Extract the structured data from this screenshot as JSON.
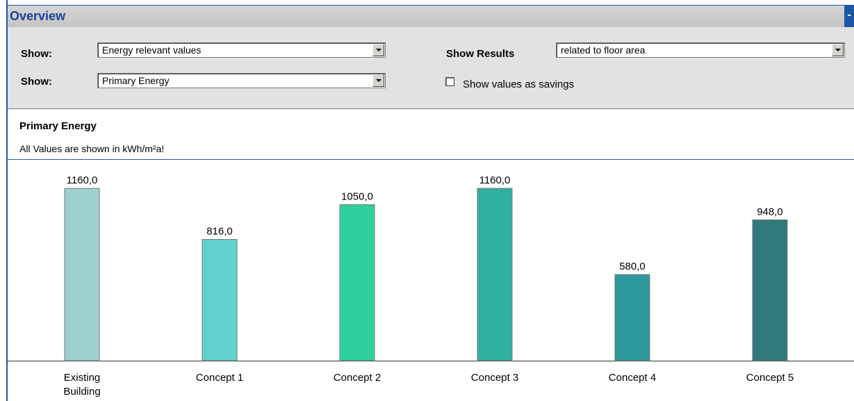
{
  "panel": {
    "title": "Overview",
    "collapse_glyph": "-"
  },
  "controls": {
    "show1_label": "Show:",
    "show1_value": "Energy relevant values",
    "show2_label": "Show:",
    "show2_value": "Primary Energy",
    "results_label": "Show Results",
    "results_value": "related to floor area",
    "savings_checkbox_label": "Show values as savings",
    "savings_checked": false
  },
  "section": {
    "heading": "Primary Energy",
    "units_note": "All Values are shown in kWh/m²a!"
  },
  "chart_data": {
    "type": "bar",
    "categories": [
      "Existing Building",
      "Concept 1",
      "Concept 2",
      "Concept 3",
      "Concept 4",
      "Concept 5"
    ],
    "values": [
      1160.0,
      816.0,
      1050.0,
      1160.0,
      580.0,
      948.0
    ],
    "value_labels": [
      "1160,0",
      "816,0",
      "1050,0",
      "1160,0",
      "580,0",
      "948,0"
    ],
    "colors": [
      "#9ecfcf",
      "#63d0d0",
      "#2fd09e",
      "#30b19e",
      "#2e999c",
      "#307a7c"
    ],
    "title": "",
    "xlabel": "",
    "ylabel": "",
    "ylim": [
      0,
      1160
    ],
    "grid": false
  }
}
